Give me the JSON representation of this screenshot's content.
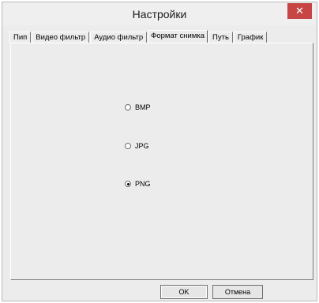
{
  "window": {
    "title": "Настройки",
    "close_label": "✕"
  },
  "tabs": [
    {
      "label": "Пип",
      "active": false
    },
    {
      "label": "Видео фильтр",
      "active": false
    },
    {
      "label": "Аудио фильтр",
      "active": false
    },
    {
      "label": "Формат снимка",
      "active": true
    },
    {
      "label": "Путь",
      "active": false
    },
    {
      "label": "График",
      "active": false
    }
  ],
  "format_options": [
    {
      "label": "BMP",
      "checked": false
    },
    {
      "label": "JPG",
      "checked": false
    },
    {
      "label": "PNG",
      "checked": true
    }
  ],
  "buttons": {
    "ok": "OK",
    "cancel": "Отмена"
  }
}
